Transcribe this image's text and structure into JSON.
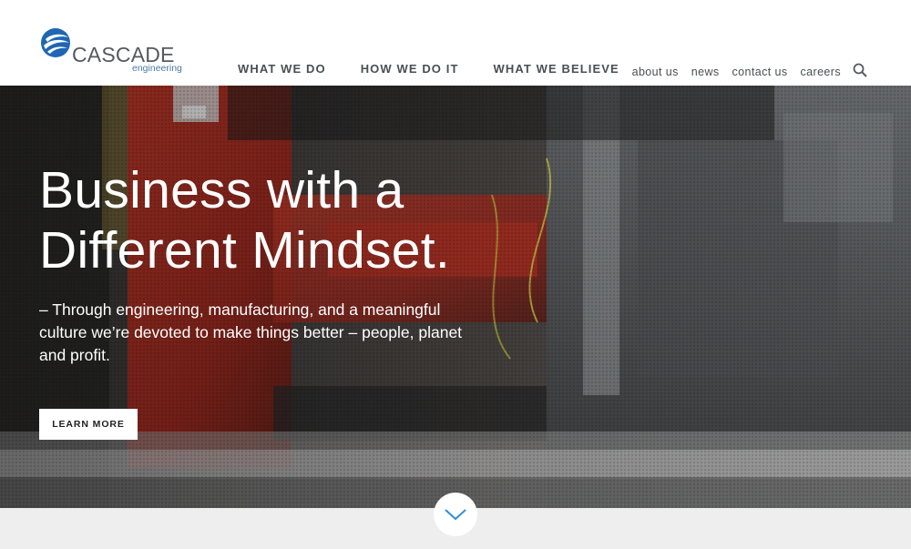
{
  "brand": {
    "name": "CASCADE",
    "tagline": "engineering",
    "logo_icon": "cascade-globe-logo",
    "colors": {
      "blue": "#1f66b3",
      "gray": "#555a5e"
    }
  },
  "main_nav": [
    {
      "label": "WHAT WE DO"
    },
    {
      "label": "HOW WE DO IT"
    },
    {
      "label": "WHAT WE BELIEVE"
    }
  ],
  "util_nav": [
    {
      "label": "about us"
    },
    {
      "label": "news"
    },
    {
      "label": "contact us"
    },
    {
      "label": "careers"
    }
  ],
  "search": {
    "icon": "search-icon"
  },
  "hero": {
    "title_line1": "Business with a",
    "title_line2": "Different Mindset.",
    "subtitle": "– Through engineering, manufacturing, and a meaningful culture we’re devoted to make things better – people, planet and profit.",
    "cta_label": "LEARN MORE",
    "background": "industrial-machinery-photo"
  },
  "scroll": {
    "icon": "chevron-down-icon",
    "color": "#2a8fd6"
  }
}
